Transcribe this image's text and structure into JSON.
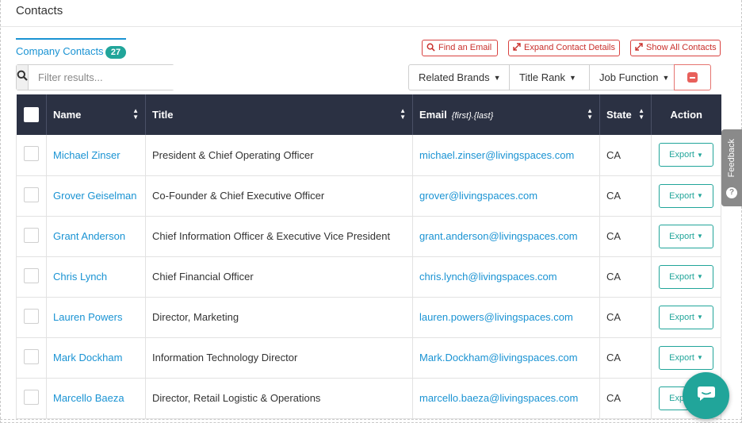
{
  "header": {
    "title": "Contacts"
  },
  "tabs": [
    {
      "label": "Company Contacts",
      "count": "27"
    }
  ],
  "actions": {
    "find_email": "Find an Email",
    "expand_details": "Expand Contact Details",
    "show_all": "Show All Contacts"
  },
  "search": {
    "placeholder": "Filter results..."
  },
  "filters": {
    "related_brands": "Related Brands",
    "title_rank": "Title Rank",
    "job_function": "Job Function"
  },
  "table": {
    "headers": {
      "name": "Name",
      "title": "Title",
      "email": "Email",
      "email_hint": "{first}.{last}",
      "state": "State",
      "action": "Action"
    },
    "rows": [
      {
        "name": "Michael Zinser",
        "title": "President & Chief Operating Officer",
        "email": "michael.zinser@livingspaces.com",
        "state": "CA",
        "action": "Export"
      },
      {
        "name": "Grover Geiselman",
        "title": "Co-Founder & Chief Executive Officer",
        "email": "grover@livingspaces.com",
        "state": "CA",
        "action": "Export"
      },
      {
        "name": "Grant Anderson",
        "title": "Chief Information Officer & Executive Vice President",
        "email": "grant.anderson@livingspaces.com",
        "state": "CA",
        "action": "Export"
      },
      {
        "name": "Chris Lynch",
        "title": "Chief Financial Officer",
        "email": "chris.lynch@livingspaces.com",
        "state": "CA",
        "action": "Export"
      },
      {
        "name": "Lauren Powers",
        "title": "Director, Marketing",
        "email": "lauren.powers@livingspaces.com",
        "state": "CA",
        "action": "Export"
      },
      {
        "name": "Mark Dockham",
        "title": "Information Technology Director",
        "email": "Mark.Dockham@livingspaces.com",
        "state": "CA",
        "action": "Export"
      },
      {
        "name": "Marcello Baeza",
        "title": "Director, Retail Logistic & Operations",
        "email": "marcello.baeza@livingspaces.com",
        "state": "CA",
        "action": "Export"
      }
    ]
  },
  "feedback": {
    "label": "Feedback"
  },
  "colors": {
    "accent": "#1a93d3",
    "teal": "#21a59a",
    "danger": "#d9413f",
    "header_bg": "#2b3143"
  },
  "icons": [
    "search-icon",
    "expand-icon",
    "caret-down-icon",
    "sort-icon",
    "minus-icon",
    "chat-icon",
    "question-icon"
  ]
}
